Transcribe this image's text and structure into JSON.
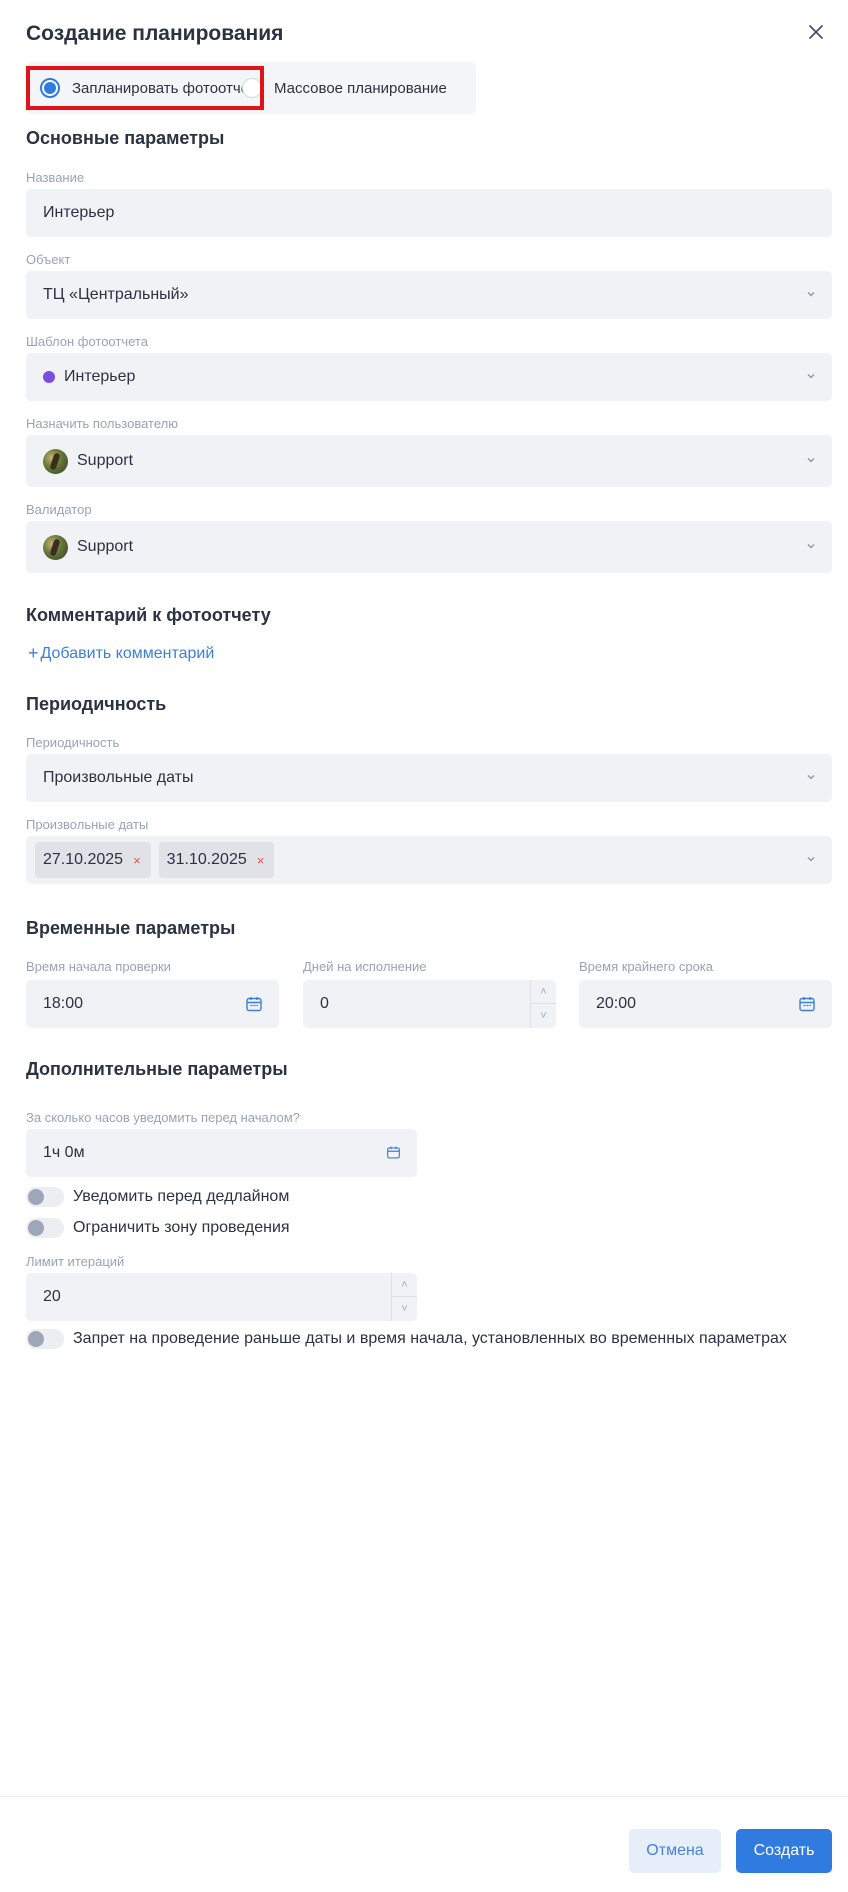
{
  "modal": {
    "title": "Создание планирования",
    "close_icon": "close-icon"
  },
  "mode": {
    "options": [
      {
        "label": "Запланировать фотоотчет",
        "checked": true
      },
      {
        "label": "Массовое планирование",
        "checked": false
      }
    ]
  },
  "basic": {
    "title": "Основные параметры",
    "name": {
      "label": "Название",
      "value": "Интерьер"
    },
    "object": {
      "label": "Объект",
      "value": "ТЦ «Центральный»"
    },
    "template": {
      "label": "Шаблон фотоотчета",
      "value": "Интерьер",
      "dot_color": "#7a4fe0"
    },
    "assignee": {
      "label": "Назначить пользователю",
      "value": "Support"
    },
    "validator": {
      "label": "Валидатор",
      "value": "Support"
    }
  },
  "comment": {
    "title": "Комментарий к фотоотчету",
    "add_link": "Добавить комментарий",
    "add_prefix": "+"
  },
  "periodicity": {
    "title": "Периодичность",
    "period": {
      "label": "Периодичность",
      "value": "Произвольные даты"
    },
    "dates": {
      "label": "Произвольные даты",
      "chips": [
        "27.10.2025",
        "31.10.2025"
      ],
      "remove_glyph": "×"
    }
  },
  "time": {
    "title": "Временные параметры",
    "start": {
      "label": "Время начала проверки",
      "value": "18:00"
    },
    "days": {
      "label": "Дней на исполнение",
      "value": "0"
    },
    "deadline": {
      "label": "Время крайнего срока",
      "value": "20:00"
    },
    "stepper_up": "˄",
    "stepper_down": "˅"
  },
  "extra": {
    "title": "Дополнительные параметры",
    "notify_before": {
      "label": "За сколько часов уведомить перед началом?",
      "value": "1ч 0м"
    },
    "toggle_deadline": {
      "label": "Уведомить перед дедлайном",
      "on": false
    },
    "toggle_zone": {
      "label": "Ограничить зону проведения",
      "on": false
    },
    "iterations": {
      "label": "Лимит итераций",
      "value": "20"
    },
    "toggle_restrict": {
      "label": "Запрет на проведение раньше даты и время начала, установленных во временных параметрах",
      "on": false
    }
  },
  "footer": {
    "cancel": "Отмена",
    "create": "Создать"
  },
  "colors": {
    "accent": "#2f7be0",
    "highlight": "#e0131b",
    "field_bg": "#f1f2f5"
  }
}
